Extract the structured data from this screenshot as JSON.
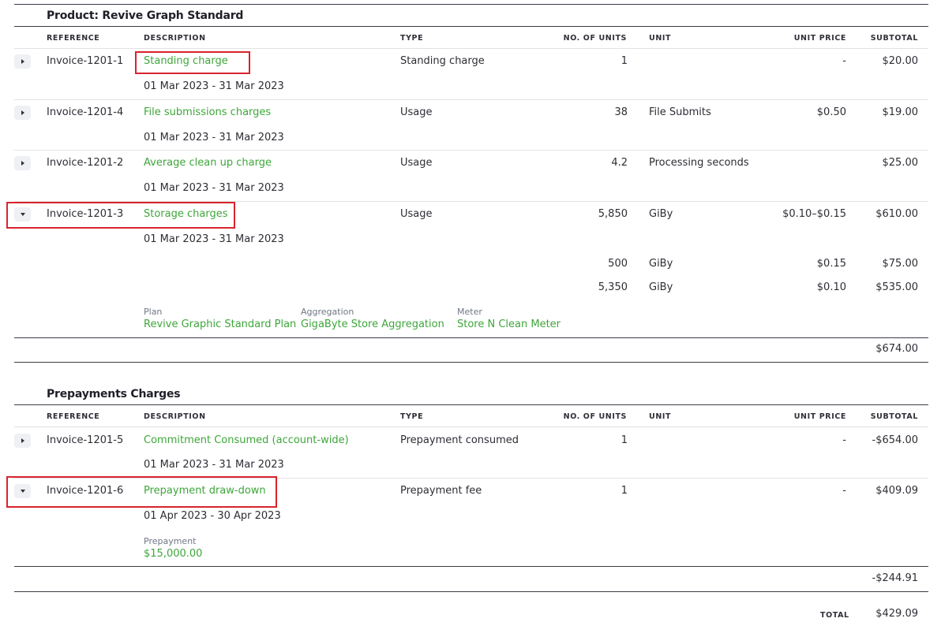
{
  "columns": {
    "reference": "REFERENCE",
    "description": "DESCRIPTION",
    "type": "TYPE",
    "units": "NO. OF UNITS",
    "unit": "UNIT",
    "unit_price": "UNIT PRICE",
    "subtotal": "SUBTOTAL"
  },
  "product_section": {
    "title": "Product: Revive Graph Standard",
    "rows": [
      {
        "reference": "Invoice-1201-1",
        "description": "Standing charge",
        "type": "Standing charge",
        "units": "1",
        "unit": "",
        "unit_price": "-",
        "subtotal": "$20.00",
        "period": "01 Mar 2023 - 31 Mar 2023",
        "expanded": false
      },
      {
        "reference": "Invoice-1201-4",
        "description": "File submissions charges",
        "type": "Usage",
        "units": "38",
        "unit": "File Submits",
        "unit_price": "$0.50",
        "subtotal": "$19.00",
        "period": "01 Mar 2023 - 31 Mar 2023",
        "expanded": false
      },
      {
        "reference": "Invoice-1201-2",
        "description": "Average clean up charge",
        "type": "Usage",
        "units": "4.2",
        "unit": "Processing seconds",
        "unit_price": "",
        "subtotal": "$25.00",
        "period": "01 Mar 2023 - 31 Mar 2023",
        "expanded": false
      },
      {
        "reference": "Invoice-1201-3",
        "description": "Storage charges",
        "type": "Usage",
        "units": "5,850",
        "unit": "GiBy",
        "unit_price": "$0.10–$0.15",
        "subtotal": "$610.00",
        "period": "01 Mar 2023 - 31 Mar 2023",
        "expanded": true
      }
    ],
    "tiers": [
      {
        "units": "500",
        "unit": "GiBy",
        "unit_price": "$0.15",
        "subtotal": "$75.00"
      },
      {
        "units": "5,350",
        "unit": "GiBy",
        "unit_price": "$0.10",
        "subtotal": "$535.00"
      }
    ],
    "details": {
      "plan_label": "Plan",
      "plan_value": "Revive Graphic Standard Plan",
      "aggregation_label": "Aggregation",
      "aggregation_value": "GigaByte Store Aggregation",
      "meter_label": "Meter",
      "meter_value": "Store N Clean Meter"
    },
    "section_total": "$674.00"
  },
  "prepayment_section": {
    "title": "Prepayments Charges",
    "rows": [
      {
        "reference": "Invoice-1201-5",
        "description": "Commitment Consumed (account-wide)",
        "type": "Prepayment consumed",
        "units": "1",
        "unit": "",
        "unit_price": "-",
        "subtotal": "-$654.00",
        "period": "01 Mar 2023 - 31 Mar 2023",
        "expanded": false
      },
      {
        "reference": "Invoice-1201-6",
        "description": "Prepayment draw-down",
        "type": "Prepayment fee",
        "units": "1",
        "unit": "",
        "unit_price": "-",
        "subtotal": "$409.09",
        "period": "01 Apr 2023 - 30 Apr 2023",
        "expanded": true
      }
    ],
    "details": {
      "prepayment_label": "Prepayment",
      "prepayment_value": "$15,000.00"
    },
    "section_total": "-$244.91"
  },
  "total": {
    "label": "TOTAL",
    "value": "$429.09"
  },
  "colors": {
    "link": "#3ea63a",
    "highlight": "#d9232d",
    "toggle_bg": "#eef0f3"
  }
}
